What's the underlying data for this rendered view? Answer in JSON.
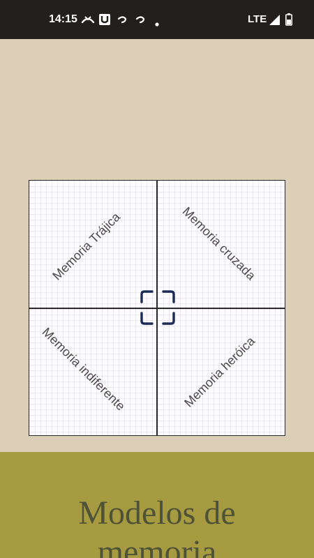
{
  "status_bar": {
    "time": "14:15",
    "network": "LTE",
    "icons": [
      "missed-call-icon",
      "u-app-icon",
      "notification-icon",
      "notification-icon",
      "dot-icon",
      "signal-icon",
      "battery-icon"
    ]
  },
  "diagram": {
    "quadrants": {
      "top_left": "Memoria Trájica",
      "top_right": "Memoria cruzada",
      "bottom_left": "Memoria indiferente",
      "bottom_right": "Memoria heróica"
    },
    "center_icon": "focus-frame-icon"
  },
  "footer": {
    "title_line1": "Modelos de",
    "title_line2": "memoria"
  },
  "colors": {
    "status_bar": "#231f1c",
    "background": "#dbcfb8",
    "footer": "#a79b41",
    "footer_text": "#4e5236",
    "focus_icon": "#1a2c55"
  }
}
